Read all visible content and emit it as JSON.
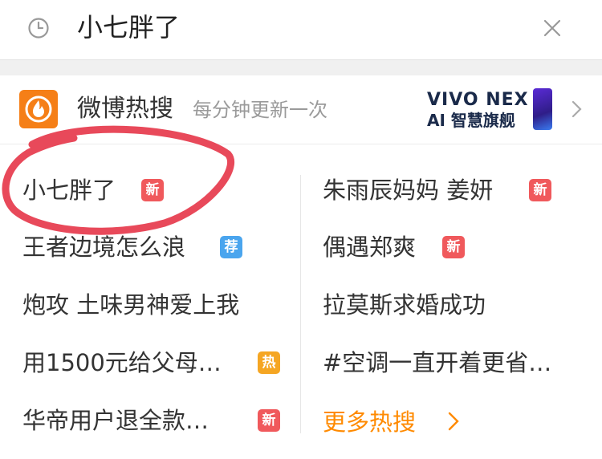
{
  "search": {
    "query": "小七胖了"
  },
  "hot": {
    "title": "微博热搜",
    "subtitle": "每分钟更新一次",
    "ad": {
      "line1": "VIVO NEX",
      "line2": "AI 智慧旗舰"
    }
  },
  "list": {
    "left": [
      {
        "text": "小七胖了",
        "badge": "新"
      },
      {
        "text": "王者边境怎么浪",
        "badge": "荐"
      },
      {
        "text": "炮攻 土味男神爱上我",
        "badge": ""
      },
      {
        "text": "用1500元给父母…",
        "badge": "热"
      },
      {
        "text": "华帝用户退全款…",
        "badge": "新"
      }
    ],
    "right": [
      {
        "text": "朱雨辰妈妈 姜妍",
        "badge": "新"
      },
      {
        "text": "偶遇郑爽",
        "badge": "新"
      },
      {
        "text": "拉莫斯求婚成功",
        "badge": ""
      },
      {
        "text": "#空调一直开着更省…",
        "badge": ""
      }
    ],
    "more": "更多热搜"
  },
  "colors": {
    "accent": "#ff8a00",
    "badge_new": "#f0595c",
    "badge_recommend": "#4aa5ee",
    "badge_hot": "#f5a623",
    "annotation": "#e8495a"
  }
}
